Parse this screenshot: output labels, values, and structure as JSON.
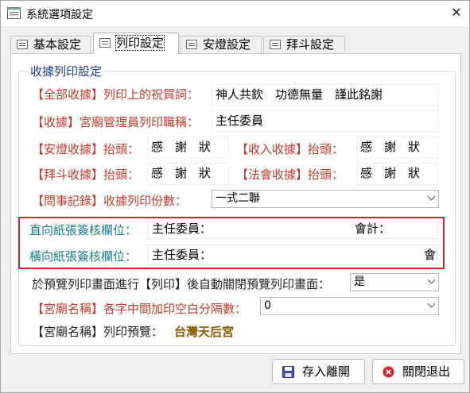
{
  "window": {
    "title": "系統選項設定",
    "close_symbol": "✕"
  },
  "tabs": [
    {
      "label": "基本設定",
      "active": false
    },
    {
      "label": "列印設定",
      "active": true
    },
    {
      "label": "安燈設定",
      "active": false
    },
    {
      "label": "拜斗設定",
      "active": false
    }
  ],
  "group": {
    "title": "收據列印設定"
  },
  "rows": {
    "greeting": {
      "label": "【全部收據】列印上的祝賀詞：",
      "value": "神人共欽　功德無量　謹此銘謝"
    },
    "manager_title": {
      "label": "【收據】宮廟管理員列印職稱：",
      "value": "主任委員"
    },
    "lamp_header": {
      "label": "【安燈收據】抬頭：",
      "value": "感　謝　狀"
    },
    "income_header": {
      "label": "【收入收據】抬頭：",
      "value": "感　謝　狀"
    },
    "dipper_header": {
      "label": "【拜斗收據】抬頭：",
      "value": "感　謝　狀"
    },
    "ritual_header": {
      "label": "【法會收據】抬頭：",
      "value": "感　謝　狀"
    },
    "copies": {
      "label": "【問事記錄】收據列印份數：",
      "value": "一式二聯"
    },
    "vertical_sign": {
      "label": "直向紙張簽核欄位：",
      "value_left": "主任委員：",
      "value_right": "會計："
    },
    "horizontal_sign": {
      "label": "橫向紙張簽核欄位：",
      "value_left": "主任委員：",
      "value_right": "會"
    },
    "auto_close": {
      "label": "於預覽列印畫面進行【列印】後自動關閉預覽列印畫面：",
      "value": "是"
    },
    "name_spacing": {
      "label": "【宮廟名稱】各字中間加印空白分隔數：",
      "value": "0"
    },
    "name_preview": {
      "label": "【宮廟名稱】列印預覽：",
      "value": "台灣天后宮"
    }
  },
  "buttons": {
    "save": {
      "label": "存入離開",
      "icon": "save-disk-icon"
    },
    "exit": {
      "label": "關閉退出",
      "icon": "close-circle-icon"
    }
  },
  "colors": {
    "red_label": "#c0392b",
    "teal_label": "#1a7a8c",
    "highlight_box": "#d9232d",
    "preview_text": "#8a5a00"
  }
}
